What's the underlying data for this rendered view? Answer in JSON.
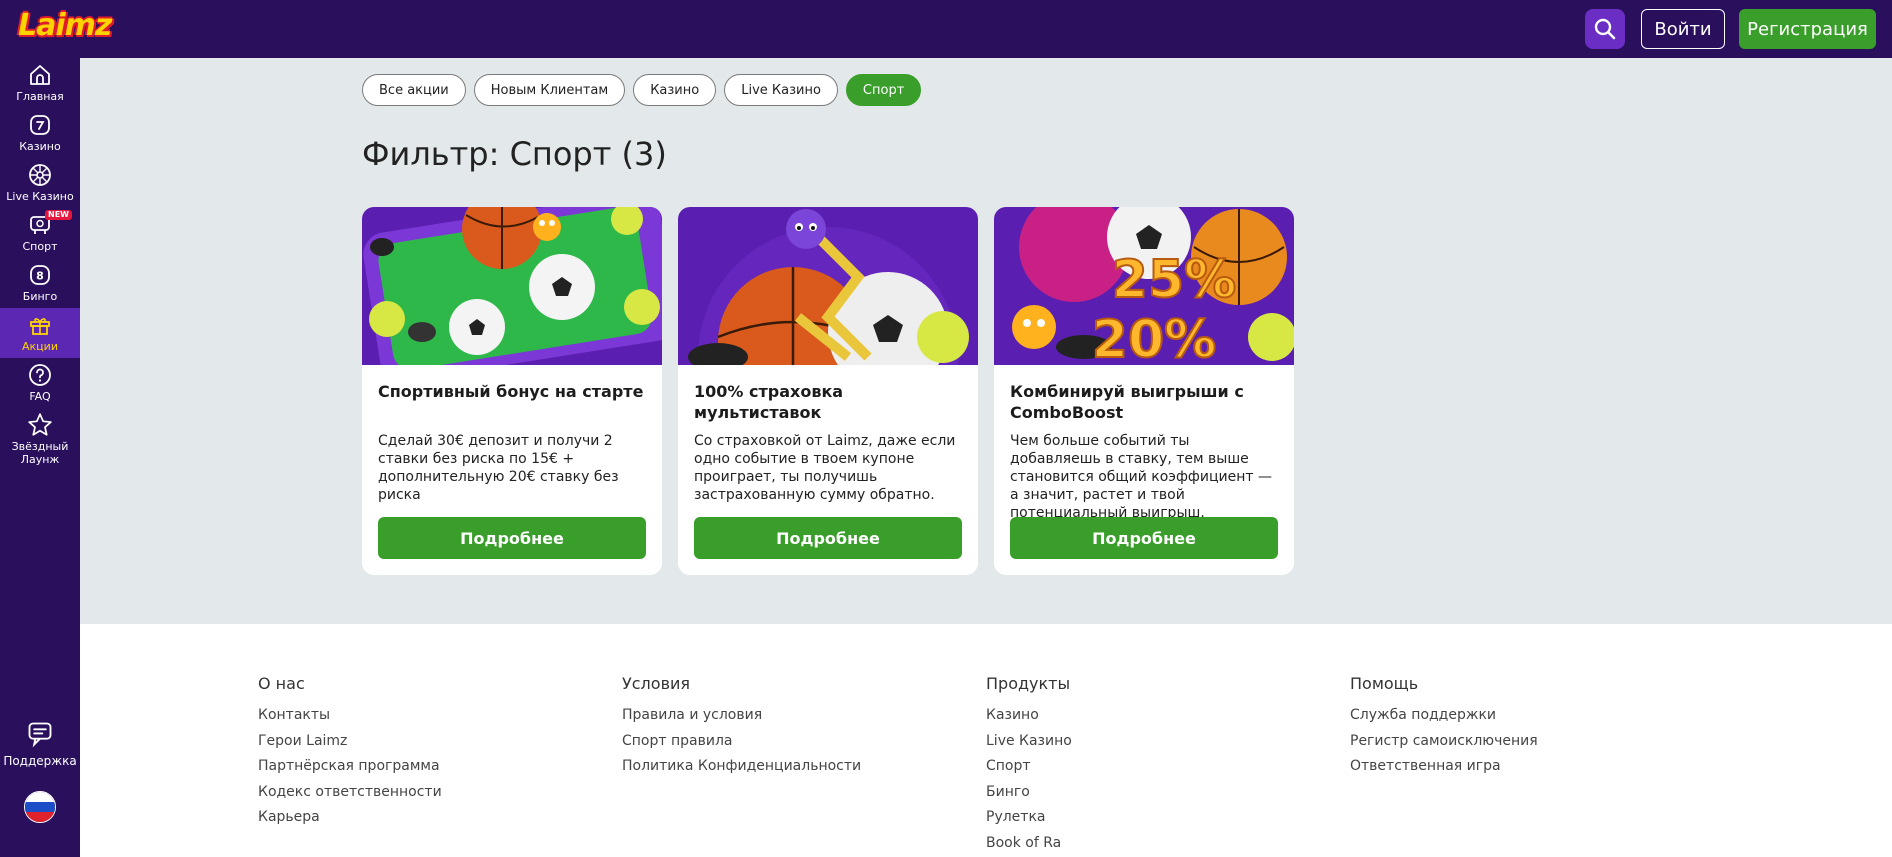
{
  "header": {
    "logo_text": "Laimz",
    "login_label": "Войти",
    "register_label": "Регистрация"
  },
  "sidebar": {
    "items": [
      {
        "label": "Главная",
        "icon": "home-icon"
      },
      {
        "label": "Казино",
        "icon": "casino-icon"
      },
      {
        "label": "Live Казино",
        "icon": "roulette-icon"
      },
      {
        "label": "Спорт",
        "icon": "sport-icon",
        "badge": "NEW"
      },
      {
        "label": "Бинго",
        "icon": "bingo-icon"
      },
      {
        "label": "Акции",
        "icon": "gift-icon",
        "active": true
      },
      {
        "label": "FAQ",
        "icon": "question-icon"
      },
      {
        "label": "Звёздный Лаунж",
        "icon": "star-icon"
      }
    ],
    "support_label": "Поддержка",
    "language": "ru"
  },
  "filters": [
    {
      "label": "Все акции",
      "active": false
    },
    {
      "label": "Новым Клиентам",
      "active": false
    },
    {
      "label": "Казино",
      "active": false
    },
    {
      "label": "Live Казино",
      "active": false
    },
    {
      "label": "Спорт",
      "active": true
    }
  ],
  "page_title": "Фильтр: Спорт (3)",
  "cards": [
    {
      "title": "Спортивный бонус на старте",
      "description": "Сделай 30€ депозит и получи 2 ставки без риска по 15€ + дополнительную 20€ ставку без риска",
      "button_label": "Подробнее"
    },
    {
      "title": "100% страховка мультиставок",
      "description": "Со страховкой от Laimz, даже если одно событие в твоем купоне проиграет, ты получишь застрахованную сумму обратно.",
      "button_label": "Подробнее"
    },
    {
      "title": "Комбинируй выигрыши с ComboBoost",
      "description": "Чем больше событий ты добавляешь в ставку, тем выше становится общий коэффициент — а значит, растет и твой потенциальный выигрыш.",
      "button_label": "Подробнее",
      "image_text_1": "25%",
      "image_text_2": "20%"
    }
  ],
  "footer": {
    "columns": [
      {
        "title": "О нас",
        "links": [
          "Контакты",
          "Герои Laimz",
          "Партнёрская программа",
          "Кодекс ответственности",
          "Карьера"
        ]
      },
      {
        "title": "Условия",
        "links": [
          "Правила и условия",
          "Спорт правила",
          "Политика Конфиденциальности"
        ]
      },
      {
        "title": "Продукты",
        "links": [
          "Казино",
          "Live Казино",
          "Спорт",
          "Бинго",
          "Рулетка",
          "Book of Ra"
        ]
      },
      {
        "title": "Помощь",
        "links": [
          "Служба поддержки",
          "Регистр самоисключения",
          "Ответственная игра"
        ]
      }
    ]
  },
  "colors": {
    "brand_purple": "#2a0f5c",
    "accent_green": "#3a9e2b",
    "active_yellow": "#ffd400"
  }
}
